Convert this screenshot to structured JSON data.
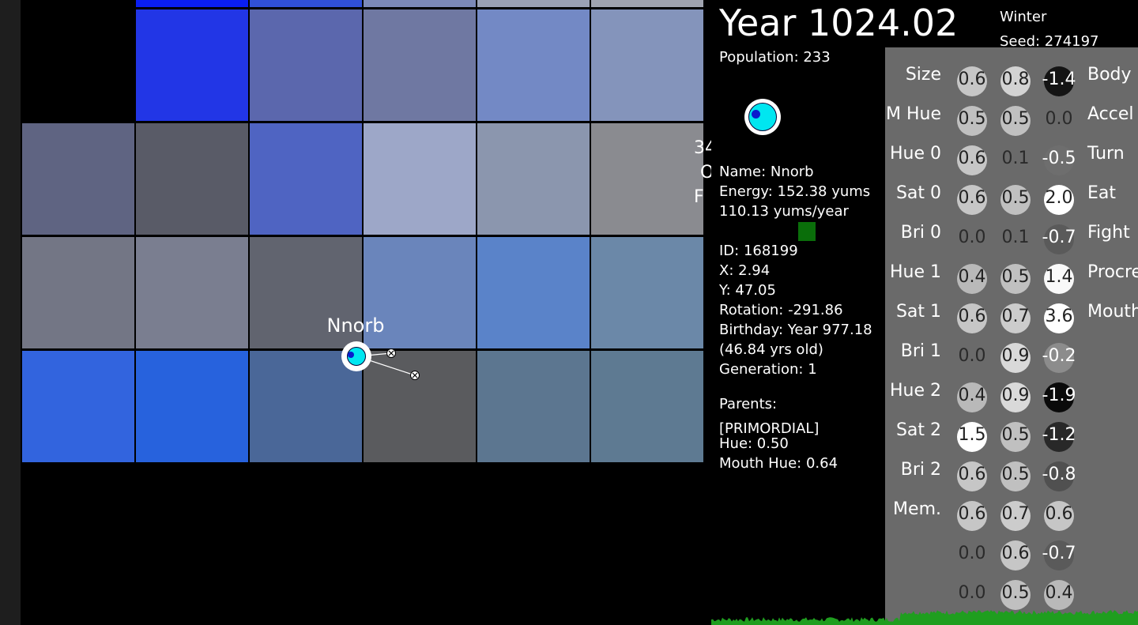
{
  "header": {
    "year": "Year 1024.02",
    "season": "Winter",
    "seed": "Seed: 274197",
    "population": "Population: 233"
  },
  "map": {
    "tile_colors": [
      [
        "#000000",
        "#0a1ef2",
        "#3050d8",
        "#7c89b8",
        "#9aa1b5",
        "#a0a4b0"
      ],
      [
        "#000000",
        "#2236e6",
        "#5b67ad",
        "#6f78a2",
        "#7389c5",
        "#8494bb"
      ],
      [
        "#5f6482",
        "#595b67",
        "#4f64c2",
        "#9da7c8",
        "#8b96ae",
        "#8a8b90"
      ],
      [
        "#737685",
        "#7a7e90",
        "#61646f",
        "#6a85bb",
        "#5a83c9",
        "#6b88a8"
      ],
      [
        "#3264de",
        "#2762dd",
        "#4a6798",
        "#5a5b5e",
        "#5c7690",
        "#5e7a92"
      ]
    ],
    "offmap_label": [
      "34",
      "O",
      "F"
    ],
    "creature_label": "Nnorb"
  },
  "selected": {
    "name": "Name: Nnorb",
    "energy": "Energy: 152.38 yums",
    "energy_rate": "110.13 yums/year",
    "id": "ID: 168199",
    "x": "X: 2.94",
    "y": "Y: 47.05",
    "rotation": "Rotation: -291.86",
    "birthday": "Birthday: Year 977.18",
    "age": "(46.84 yrs old)",
    "generation": "Generation: 1",
    "parents_label": "Parents:",
    "parents_value": "[PRIMORDIAL]",
    "hue": "Hue: 0.50",
    "mouth_hue": "Mouth Hue: 0.64"
  },
  "brain": {
    "input_labels": [
      "Size",
      "M Hue",
      "Hue 0",
      "Sat 0",
      "Bri 0",
      "Hue 1",
      "Sat 1",
      "Bri 1",
      "Hue 2",
      "Sat 2",
      "Bri 2",
      "Mem.",
      "",
      ""
    ],
    "output_labels": [
      "Body",
      "Accel",
      "Turn",
      "Eat",
      "Fight",
      "Procre",
      "Mouth"
    ],
    "columns": [
      [
        "0.6",
        "0.5",
        "0.6",
        "0.6",
        "0.0",
        "0.4",
        "0.6",
        "0.0",
        "0.4",
        "1.5",
        "0.6",
        "0.6",
        "0.0",
        "0.0"
      ],
      [
        "0.8",
        "0.5",
        "0.1",
        "0.5",
        "0.1",
        "0.5",
        "0.7",
        "0.9",
        "0.9",
        "0.5",
        "0.5",
        "0.7",
        "0.6",
        "0.5"
      ],
      [
        "-1.4",
        "0.0",
        "-0.5",
        "2.0",
        "-0.7",
        "1.4",
        "3.6",
        "-0.2",
        "-1.9",
        "-1.2",
        "-0.8",
        "0.6",
        "-0.7",
        "0.4"
      ]
    ],
    "column_numbers": [
      [
        0.6,
        0.5,
        0.6,
        0.6,
        0.0,
        0.4,
        0.6,
        0.0,
        0.4,
        1.5,
        0.6,
        0.6,
        0.0,
        0.0
      ],
      [
        0.8,
        0.5,
        0.1,
        0.5,
        0.1,
        0.5,
        0.7,
        0.9,
        0.9,
        0.5,
        0.5,
        0.7,
        0.6,
        0.5
      ],
      [
        -1.4,
        0.0,
        -0.5,
        2.0,
        -0.7,
        1.4,
        3.6,
        -0.2,
        -1.9,
        -1.2,
        -0.8,
        0.6,
        -0.7,
        0.4
      ]
    ]
  },
  "colors": {
    "creature_body": "#00e6f0",
    "creature_eye": "#0a1acd",
    "energy_green": "#0a6e0a",
    "graph_green": "#1f9e1f"
  }
}
